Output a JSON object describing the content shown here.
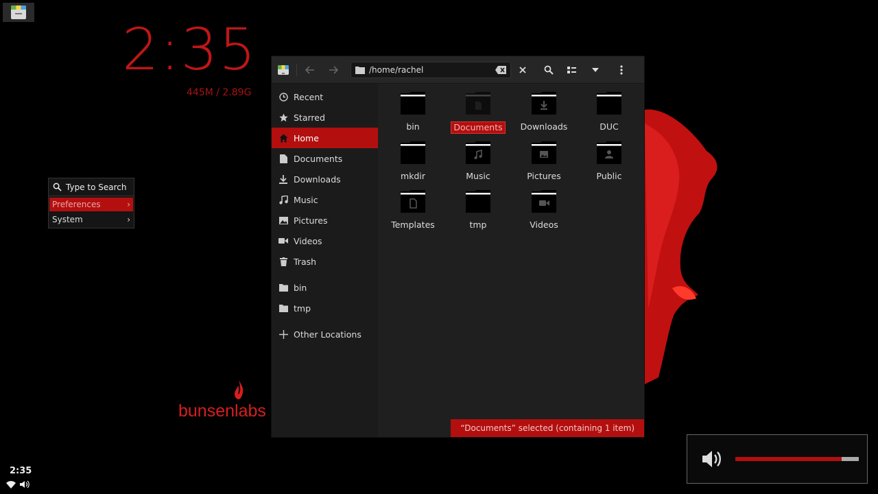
{
  "desktop": {
    "conky": {
      "time": "2:35",
      "memory": "445M / 2.89G"
    },
    "logo_text": "bunsenlabs",
    "root_menu": {
      "search_label": "Type to Search",
      "items": [
        {
          "label": "Preferences",
          "arrow": "›",
          "active": true
        },
        {
          "label": "System",
          "arrow": "›",
          "active": false
        }
      ]
    },
    "tray": {
      "time": "2:35"
    },
    "volume_osd": {
      "level_percent": 86
    }
  },
  "file_manager": {
    "path": "/home/rachel",
    "sidebar": {
      "places": [
        {
          "label": "Recent",
          "icon": "clock-icon"
        },
        {
          "label": "Starred",
          "icon": "star-icon"
        },
        {
          "label": "Home",
          "icon": "home-icon",
          "active": true
        },
        {
          "label": "Documents",
          "icon": "document-icon"
        },
        {
          "label": "Downloads",
          "icon": "download-icon"
        },
        {
          "label": "Music",
          "icon": "music-icon"
        },
        {
          "label": "Pictures",
          "icon": "picture-icon"
        },
        {
          "label": "Videos",
          "icon": "video-icon"
        },
        {
          "label": "Trash",
          "icon": "trash-icon"
        }
      ],
      "bookmarks": [
        {
          "label": "bin",
          "icon": "folder-icon"
        },
        {
          "label": "tmp",
          "icon": "folder-icon"
        }
      ],
      "other": {
        "label": "Other Locations",
        "icon": "plus-icon"
      }
    },
    "files": [
      {
        "name": "bin",
        "emblem": ""
      },
      {
        "name": "Documents",
        "emblem": "document",
        "selected": true
      },
      {
        "name": "Downloads",
        "emblem": "download"
      },
      {
        "name": "DUC",
        "emblem": ""
      },
      {
        "name": "mkdir",
        "emblem": ""
      },
      {
        "name": "Music",
        "emblem": "music"
      },
      {
        "name": "Pictures",
        "emblem": "picture"
      },
      {
        "name": "Public",
        "emblem": "user"
      },
      {
        "name": "Templates",
        "emblem": "template"
      },
      {
        "name": "tmp",
        "emblem": ""
      },
      {
        "name": "Videos",
        "emblem": "video"
      }
    ],
    "status": "“Documents” selected  (containing 1 item)"
  }
}
